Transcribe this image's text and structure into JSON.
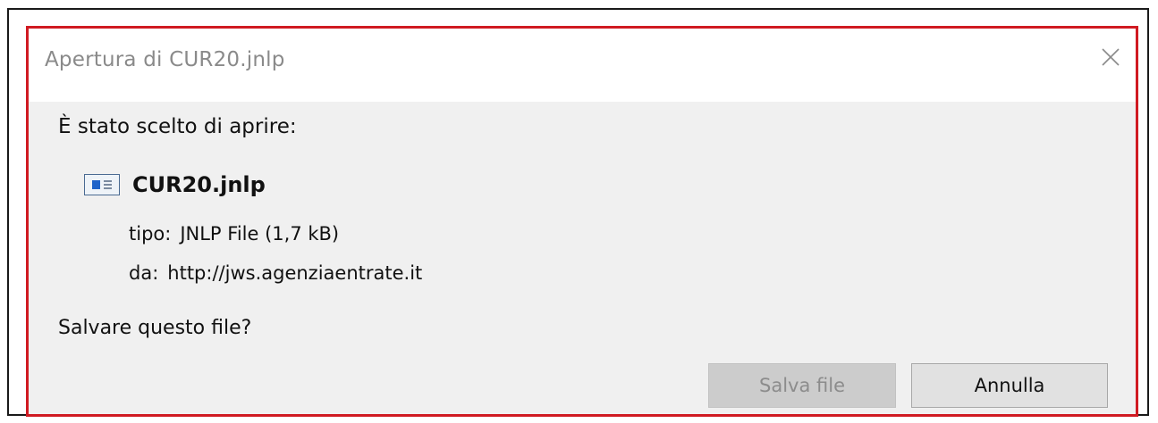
{
  "dialog": {
    "title": "Apertura di CUR20.jnlp",
    "prompt": "È stato scelto di aprire:",
    "file": {
      "name": "CUR20.jnlp",
      "icon": "jnlp-file-icon",
      "type_label": "tipo:",
      "type_value": "JNLP File (1,7 kB)",
      "from_label": "da:",
      "from_value": "http://jws.agenziaentrate.it"
    },
    "question": "Salvare questo file?",
    "buttons": {
      "save_label": "Salva file",
      "save_enabled": false,
      "cancel_label": "Annulla"
    },
    "close_icon": "close-icon",
    "highlight_color": "#d01a22"
  }
}
